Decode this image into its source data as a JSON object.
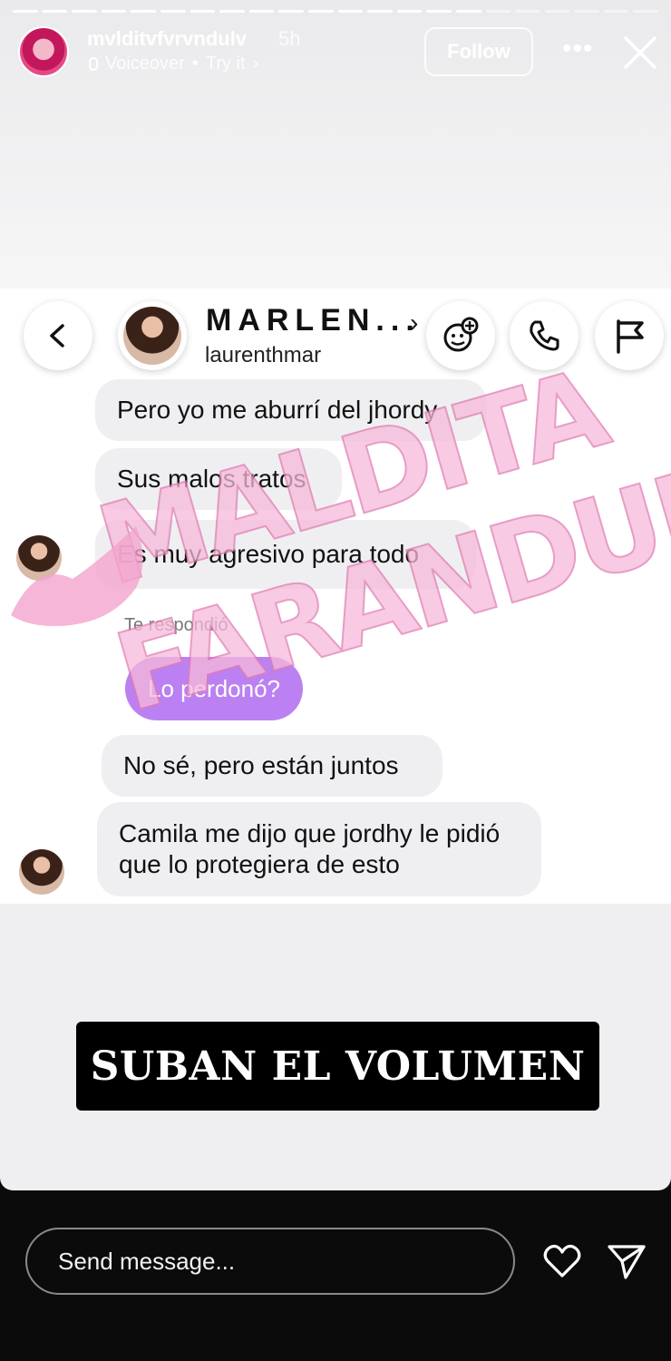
{
  "story": {
    "progress_total": 22,
    "progress_done": 16,
    "username": "mvlditvfvrvndulv",
    "time": "5h",
    "subtitle": "Voiceover",
    "subtitle_action": "Try it",
    "follow_label": "Follow",
    "more_icon": "more-horizontal-icon",
    "close_icon": "close-icon"
  },
  "dm": {
    "name": "MARLEN...",
    "handle": "laurenthmar",
    "icons": [
      "back-icon",
      "sticker-add-icon",
      "phone-icon",
      "flag-icon"
    ],
    "messages": [
      "Pero yo me aburrí del jhordy",
      "Sus malos tratos",
      "Es muy agresivo para todo"
    ],
    "replied_label": "Te respondió",
    "reply_bubble": "Lo perdonó?",
    "messages2": [
      "No sé, pero están juntos",
      "Camila me dijo que jordhy le pidió",
      "que lo protegiera de esto"
    ],
    "watermark_line1": "MALDITA",
    "watermark_line2": "FARANDULA"
  },
  "banner_text": "SUBAN EL VOLUMEN",
  "footer": {
    "placeholder": "Send message...",
    "like_icon": "heart-icon",
    "share_icon": "send-icon"
  },
  "colors": {
    "reply_bubble": "#b06cf0",
    "bubble_bg": "#efeff1",
    "watermark": "#f3a6cf",
    "background": "#0b0b0b"
  }
}
